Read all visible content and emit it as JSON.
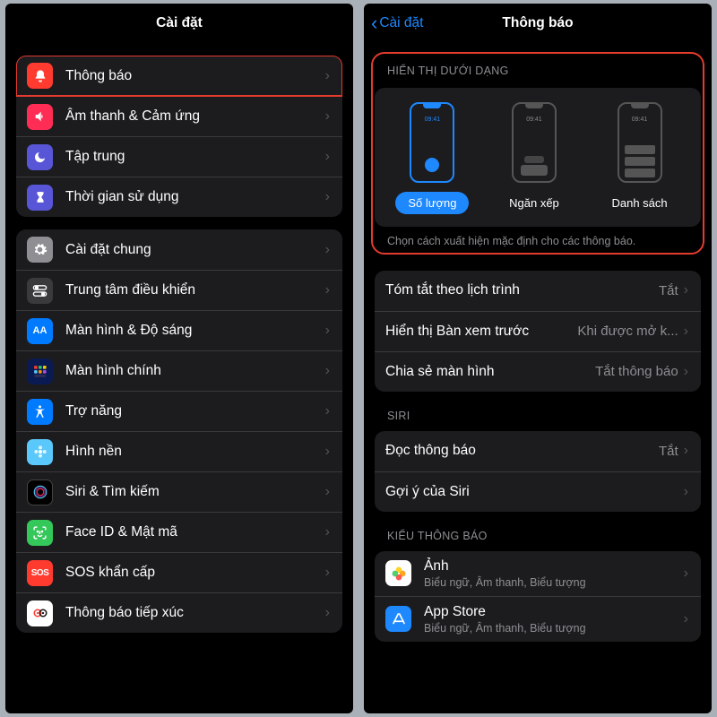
{
  "left": {
    "title": "Cài đặt",
    "group1": [
      {
        "id": "notifications",
        "label": "Thông báo",
        "highlight": true
      },
      {
        "id": "sounds",
        "label": "Âm thanh & Cảm ứng"
      },
      {
        "id": "focus",
        "label": "Tập trung"
      },
      {
        "id": "screentime",
        "label": "Thời gian sử dụng"
      }
    ],
    "group2": [
      {
        "id": "general",
        "label": "Cài đặt chung"
      },
      {
        "id": "controlcenter",
        "label": "Trung tâm điều khiển"
      },
      {
        "id": "display",
        "label": "Màn hình & Độ sáng"
      },
      {
        "id": "homescreen",
        "label": "Màn hình chính"
      },
      {
        "id": "accessibility",
        "label": "Trợ năng"
      },
      {
        "id": "wallpaper",
        "label": "Hình nền"
      },
      {
        "id": "siri",
        "label": "Siri & Tìm kiếm"
      },
      {
        "id": "faceid",
        "label": "Face ID & Mật mã"
      },
      {
        "id": "sos",
        "label": "SOS khẩn cấp"
      },
      {
        "id": "exposure",
        "label": "Thông báo tiếp xúc"
      }
    ]
  },
  "right": {
    "back": "Cài đặt",
    "title": "Thông báo",
    "displayAs": {
      "header": "HIỂN THỊ DƯỚI DẠNG",
      "time": "09:41",
      "options": [
        {
          "id": "count",
          "label": "Số lượng",
          "selected": true
        },
        {
          "id": "stack",
          "label": "Ngăn xếp",
          "selected": false
        },
        {
          "id": "list",
          "label": "Danh sách",
          "selected": false
        }
      ],
      "footer": "Chọn cách xuất hiện mặc định cho các thông báo."
    },
    "settings": [
      {
        "id": "scheduled",
        "label": "Tóm tắt theo lịch trình",
        "value": "Tắt"
      },
      {
        "id": "previews",
        "label": "Hiển thị Bàn xem trước",
        "value": "Khi được mở k..."
      },
      {
        "id": "screenshare",
        "label": "Chia sẻ màn hình",
        "value": "Tắt thông báo"
      }
    ],
    "siri": {
      "header": "SIRI",
      "rows": [
        {
          "id": "announce",
          "label": "Đọc thông báo",
          "value": "Tắt"
        },
        {
          "id": "suggest",
          "label": "Gợi ý của Siri",
          "value": ""
        }
      ]
    },
    "style": {
      "header": "KIỂU THÔNG BÁO",
      "apps": [
        {
          "id": "photos",
          "label": "Ảnh",
          "sub": "Biểu ngữ, Âm thanh, Biểu tượng"
        },
        {
          "id": "appstore",
          "label": "App Store",
          "sub": "Biểu ngữ, Âm thanh, Biểu tượng"
        }
      ]
    }
  }
}
